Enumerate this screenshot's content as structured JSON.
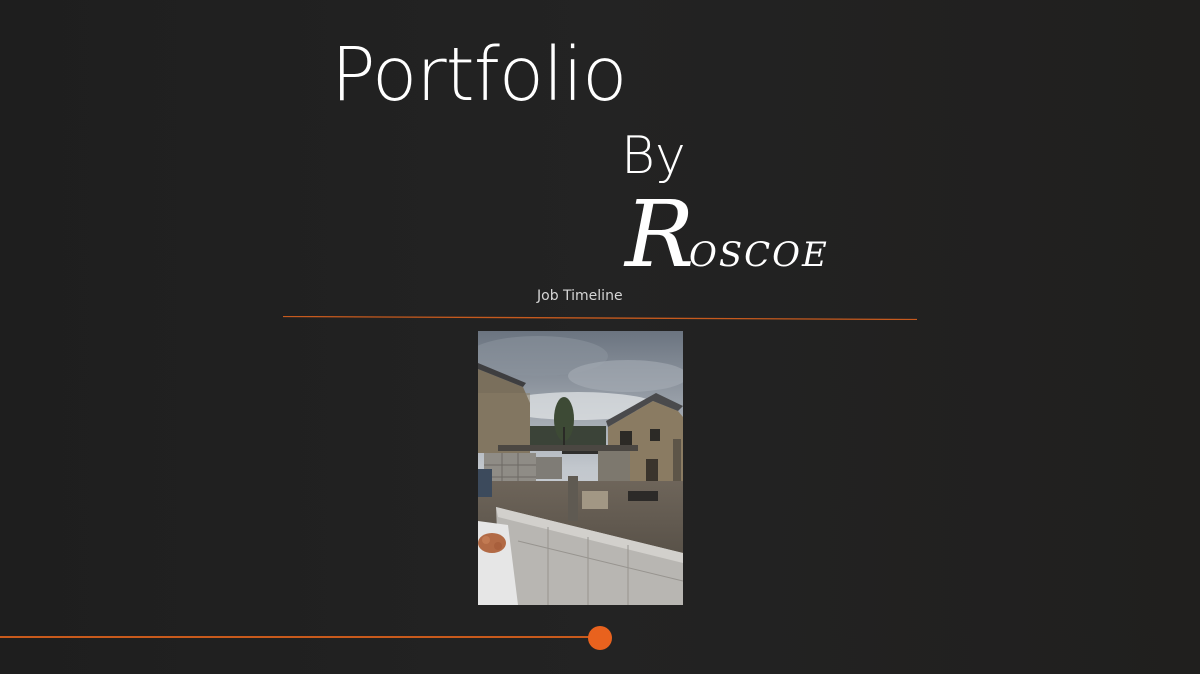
{
  "slide": {
    "title_line1": "Portfolio",
    "title_line2": "By",
    "signature_initial": "R",
    "signature_rest": "OSCOE",
    "subtitle": "Job Timeline"
  },
  "photo": {
    "subject": "construction-site-blockwork-extension"
  },
  "colors": {
    "background": "#222222",
    "accent": "#e8621e",
    "text": "#ffffff"
  }
}
